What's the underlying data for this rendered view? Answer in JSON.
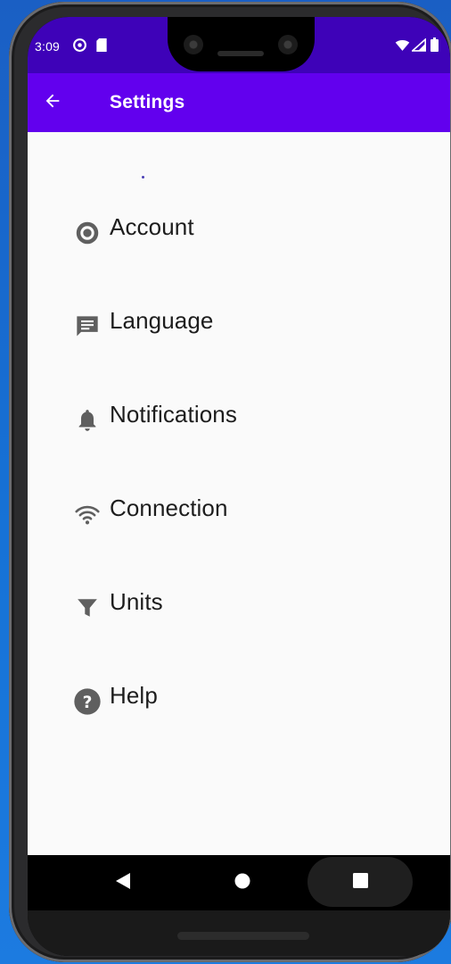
{
  "status_bar": {
    "time": "3:09",
    "left_icons": [
      "at-sign-icon",
      "sd-card-icon"
    ],
    "right_icons": [
      "wifi-icon",
      "signal-icon",
      "battery-icon"
    ],
    "background": "#3e02b8"
  },
  "app_bar": {
    "title": "Settings",
    "back_icon": "arrow-back-icon",
    "background": "#6200ee"
  },
  "settings": {
    "items": [
      {
        "label": "Account",
        "icon": "account-circle-icon"
      },
      {
        "label": "Language",
        "icon": "chat-message-icon"
      },
      {
        "label": "Notifications",
        "icon": "bell-icon"
      },
      {
        "label": "Connection",
        "icon": "wifi-icon"
      },
      {
        "label": "Units",
        "icon": "filter-icon"
      },
      {
        "label": "Help",
        "icon": "help-circle-icon"
      }
    ],
    "icon_color": "#5f5f5f",
    "text_color": "#1d1d1d"
  },
  "nav_bar": {
    "buttons": [
      "nav-back-icon",
      "nav-home-icon",
      "nav-recents-icon"
    ]
  }
}
